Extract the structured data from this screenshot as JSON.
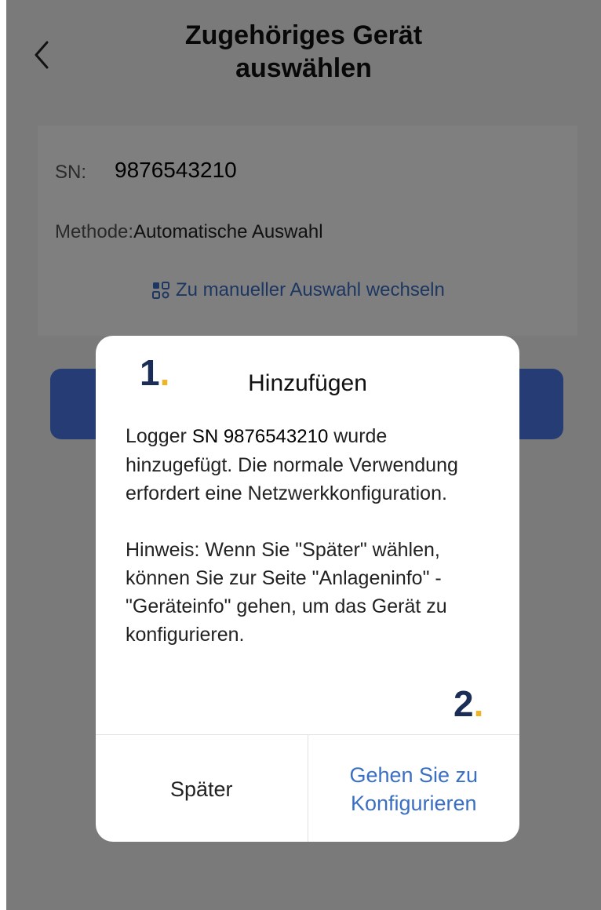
{
  "header": {
    "title_line1": "Zugehöriges Gerät",
    "title_line2": "auswählen",
    "back_icon": "chevron-left-icon"
  },
  "form": {
    "sn_label": "SN:",
    "sn_value": "9876543210",
    "method_label": "Methode:",
    "method_value": "Automatische Auswahl",
    "switch_link": "Zu manueller Auswahl wechseln",
    "switch_icon": "grid-switch-icon"
  },
  "dialog": {
    "step1_number": "1",
    "step1_dot": ".",
    "title": "Hinzufügen",
    "body_prefix": "Logger",
    "body_sn": "SN 9876543210",
    "body_rest": "wurde hinzugefügt. Die normale Verwendung erfordert eine Netzwerkkonfiguration.",
    "hint": "Hinweis: Wenn Sie \"Später\" wählen, können Sie zur Seite \"Anlageninfo\" - \"Geräteinfo\" gehen, um das Gerät zu konfigurieren.",
    "step2_number": "2",
    "step2_dot": ".",
    "later_button": "Später",
    "configure_button": "Gehen Sie zu Konfigurieren"
  },
  "colors": {
    "accent_link": "#3a6fc4",
    "primary_button": "#4a7ae8",
    "step_number": "#1a2d56",
    "step_dot": "#f0b323"
  }
}
